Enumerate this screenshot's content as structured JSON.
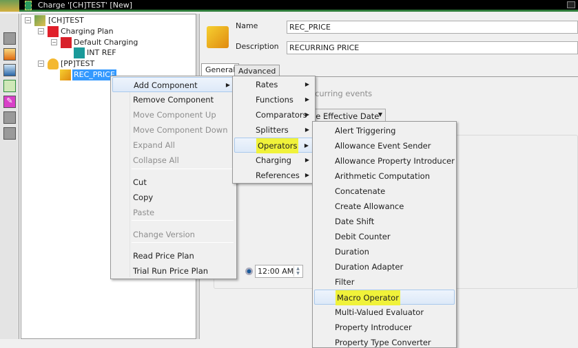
{
  "window": {
    "title": "Charge '[CH]TEST' [New]"
  },
  "tree": {
    "items": [
      {
        "label": "[CH]TEST",
        "icon": "charge-icon"
      },
      {
        "label": "Charging Plan",
        "icon": "charging-plan-icon"
      },
      {
        "label": "Default Charging",
        "icon": "charging-icon"
      },
      {
        "label": "INT REF",
        "icon": "reference-icon"
      },
      {
        "label": "[PP]TEST",
        "icon": "price-plan-icon"
      },
      {
        "label": "REC_PRICE",
        "icon": "recurring-price-icon"
      }
    ]
  },
  "form": {
    "name_label": "Name",
    "name_value": "REC_PRICE",
    "description_label": "Description",
    "description_value": "RECURRING PRICE",
    "tabs": [
      "General",
      "Advanced"
    ],
    "partial_text": "ecurring events",
    "dropdown_value": "ge Effective Date",
    "time_value": "12:00 AM"
  },
  "context_menu": {
    "items": [
      {
        "label": "Add Component",
        "disabled": false
      },
      {
        "label": "Remove Component",
        "disabled": false
      },
      {
        "label": "Move Component Up",
        "disabled": true
      },
      {
        "label": "Move Component Down",
        "disabled": true
      },
      {
        "label": "Expand All",
        "disabled": true
      },
      {
        "label": "Collapse All",
        "disabled": true
      },
      {
        "label": "Cut",
        "disabled": false
      },
      {
        "label": "Copy",
        "disabled": false
      },
      {
        "label": "Paste",
        "disabled": true
      },
      {
        "label": "Change Version",
        "disabled": true
      },
      {
        "label": "Read Price Plan",
        "disabled": false
      },
      {
        "label": "Trial Run Price Plan",
        "disabled": false
      }
    ]
  },
  "add_component_menu": {
    "items": [
      "Rates",
      "Functions",
      "Comparators",
      "Splitters",
      "Operators",
      "Charging",
      "References"
    ]
  },
  "operators_menu": {
    "items": [
      "Alert Triggering",
      "Allowance Event Sender",
      "Allowance Property Introducer",
      "Arithmetic Computation",
      "Concatenate",
      "Create Allowance",
      "Date Shift",
      "Debit Counter",
      "Duration",
      "Duration Adapter",
      "Filter",
      "Macro Operator",
      "Multi-Valued Evaluator",
      "Property Introducer",
      "Property Type Converter"
    ]
  },
  "colors": {
    "highlight": "#f0f23a",
    "selection": "#3399ff"
  }
}
